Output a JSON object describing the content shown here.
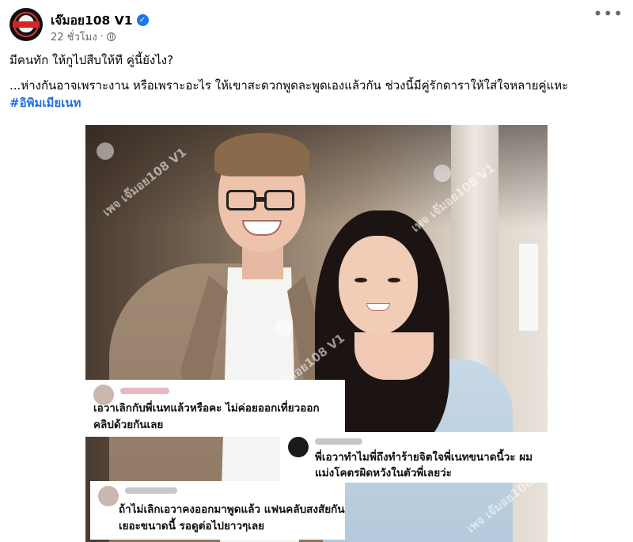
{
  "post": {
    "page_name": "เจ๊มอย108 V1",
    "time": "22 ชั่วโมง",
    "separator": "·",
    "more_label": "•••",
    "line1": "มีคนทัก ให้กูไปสืบให้ที คู่นี้ยังไง?",
    "line2": "...ห่างกันอาจเพราะงาน หรือเพราะอะไร ให้เขาสะดวกพูดละพูดเองแล้วกัน ช่วงนี้มีคู่รักดาราให้ใส่ใจหลายคู่แหะ",
    "hashtag": "#อิพิมเมียเนท"
  },
  "image": {
    "watermark": "เพจ เจ๊มอย108 V1",
    "comments": [
      {
        "line1": "เอวาเลิกกับพี่เนทแล้วหรือคะ ไม่ค่อยออกเที่ยวออก",
        "line2": "คลิปด้วยกันเลย"
      },
      {
        "line1": "พี่เอวาทำไมพี่ถึงทำร้ายจิตใจพี่เนทขนาดนี้วะ ผม",
        "line2": "แม่งโคตรผิดหวังในตัวพี่เลยว่ะ"
      },
      {
        "line1": "ถ้าไม่เลิกเอวาคงออกมาพูดแล้ว แฟนคลับสงสัยกัน",
        "line2": "เยอะขนาดนี้ รอดูต่อไปยาวๆเลย"
      }
    ]
  },
  "colors": {
    "hashtag": "#216fdb",
    "verified": "#1877f2",
    "meta": "#65676b"
  },
  "icons": {
    "verified": "verified-badge-icon",
    "audience": "globe-icon",
    "more": "more-options-icon"
  }
}
